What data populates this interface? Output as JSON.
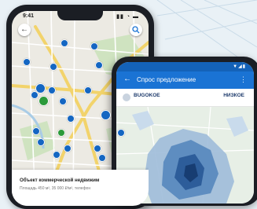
{
  "phone_left": {
    "status_time": "9:41",
    "status_icons": "▮▮ ◔ ▬",
    "info_title": "Объект коммерческой недвижим",
    "info_sub": "Площадь 450 м², 35 000 ₽/м², телефон"
  },
  "phone_right": {
    "status_icons": "▼◢▮",
    "title": "Спрос предложение",
    "tab_left": "BUGOKOE",
    "tab_left_sub": "",
    "tab_right": "НИЗКОЕ",
    "menu_icon": "more-vert-icon"
  },
  "colors": {
    "pin_blue": "#1466c2",
    "pin_green": "#2b9a3a",
    "appbar": "#1a73d4",
    "status_bar": "#1462b8"
  }
}
